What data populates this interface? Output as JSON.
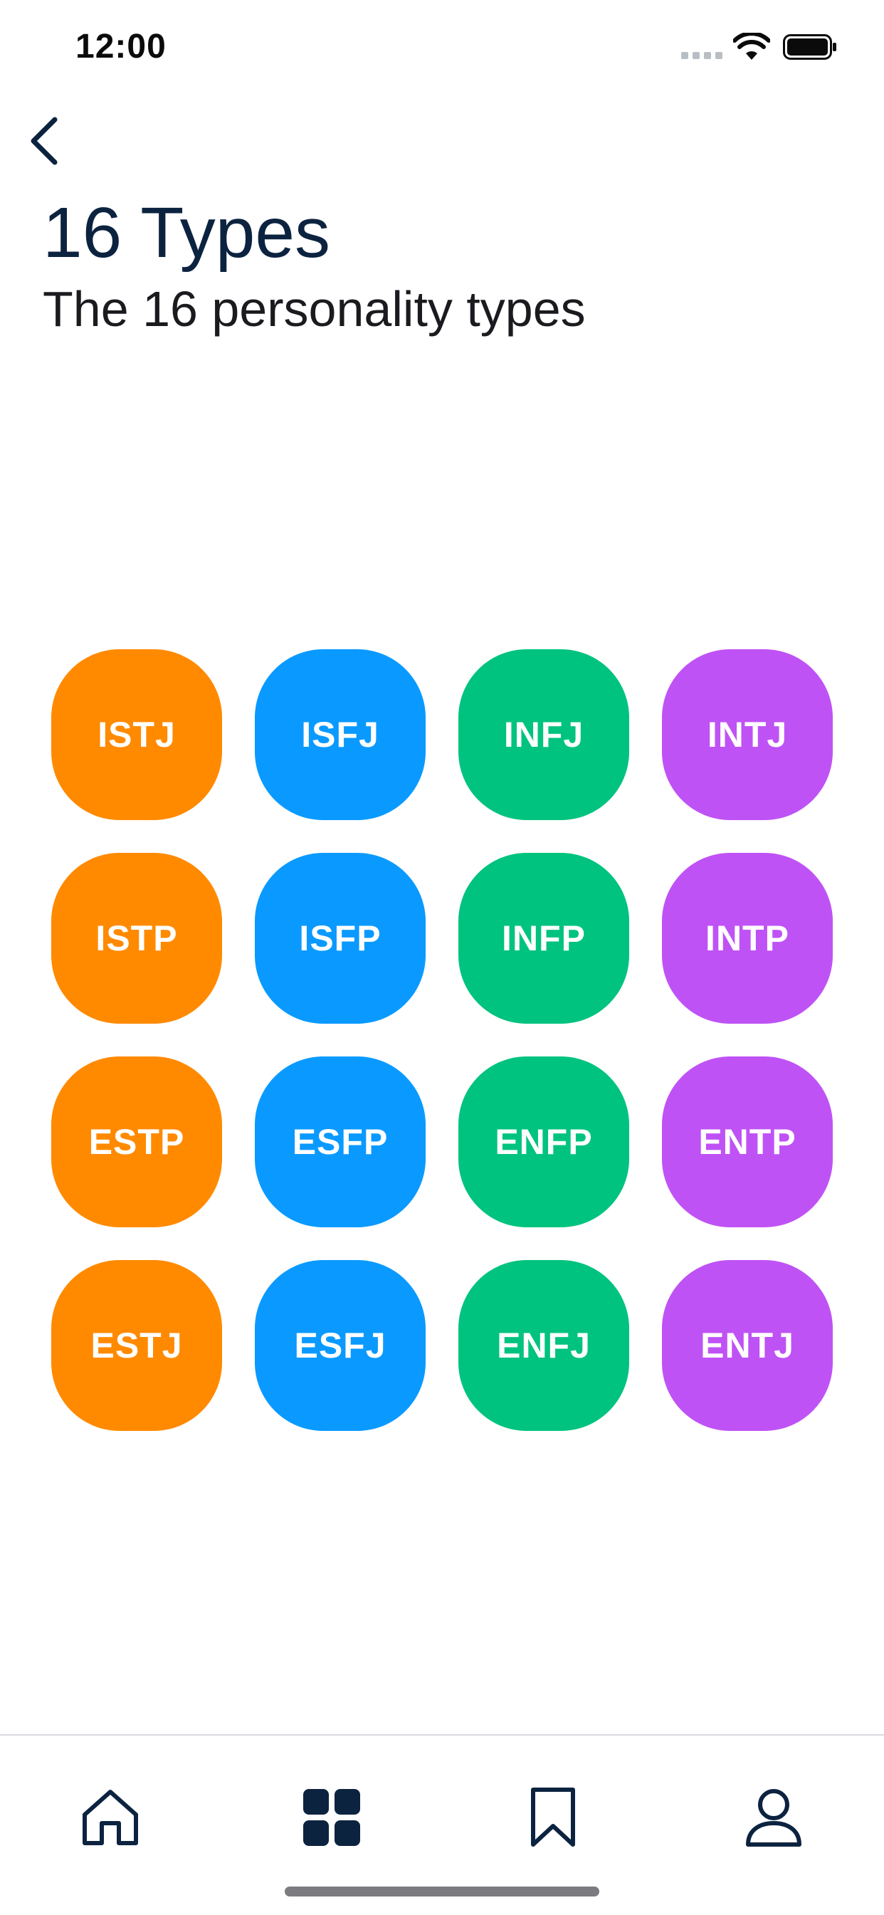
{
  "status_bar": {
    "time": "12:00"
  },
  "header": {
    "back_icon": "chevron-left-icon",
    "title": "16 Types",
    "subtitle": "The 16 personality types"
  },
  "colors": {
    "orange": "#FF8A00",
    "blue": "#0A9AFF",
    "green": "#00C37F",
    "purple": "#BF52F5",
    "navy": "#0C2340"
  },
  "types": [
    {
      "label": "ISTJ",
      "color": "#FF8A00"
    },
    {
      "label": "ISFJ",
      "color": "#0A9AFF"
    },
    {
      "label": "INFJ",
      "color": "#00C37F"
    },
    {
      "label": "INTJ",
      "color": "#BF52F5"
    },
    {
      "label": "ISTP",
      "color": "#FF8A00"
    },
    {
      "label": "ISFP",
      "color": "#0A9AFF"
    },
    {
      "label": "INFP",
      "color": "#00C37F"
    },
    {
      "label": "INTP",
      "color": "#BF52F5"
    },
    {
      "label": "ESTP",
      "color": "#FF8A00"
    },
    {
      "label": "ESFP",
      "color": "#0A9AFF"
    },
    {
      "label": "ENFP",
      "color": "#00C37F"
    },
    {
      "label": "ENTP",
      "color": "#BF52F5"
    },
    {
      "label": "ESTJ",
      "color": "#FF8A00"
    },
    {
      "label": "ESFJ",
      "color": "#0A9AFF"
    },
    {
      "label": "ENFJ",
      "color": "#00C37F"
    },
    {
      "label": "ENTJ",
      "color": "#BF52F5"
    }
  ],
  "tab_bar": {
    "items": [
      {
        "icon": "home-icon",
        "selected": false
      },
      {
        "icon": "grid-icon",
        "selected": true
      },
      {
        "icon": "bookmark-icon",
        "selected": false
      },
      {
        "icon": "profile-icon",
        "selected": false
      }
    ]
  }
}
